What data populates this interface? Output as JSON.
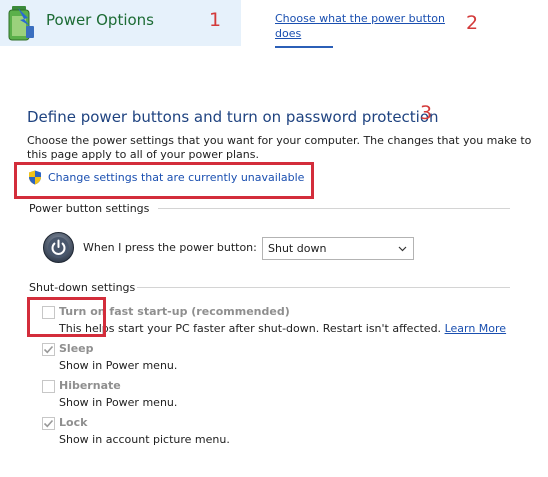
{
  "header": {
    "app_title": "Power Options",
    "side_link": "Choose what the power button does"
  },
  "annotations": {
    "one": "1",
    "two": "2",
    "three": "3"
  },
  "main": {
    "title": "Define power buttons and turn on password protection",
    "description": "Choose the power settings that you want for your computer. The changes that you make to this page apply to all of your power plans.",
    "change_settings_link": "Change settings that are currently unavailable"
  },
  "power_button_settings": {
    "section_label": "Power button settings",
    "press_label": "When I press the power button:",
    "selected_action": "Shut down"
  },
  "shutdown_settings": {
    "section_label": "Shut-down settings",
    "options": [
      {
        "title": "Turn on fast start-up (recommended)",
        "sub": "This helps start your PC faster after shut-down. Restart isn't affected.",
        "link": "Learn More",
        "checked": false
      },
      {
        "title": "Sleep",
        "sub": "Show in Power menu.",
        "checked": true
      },
      {
        "title": "Hibernate",
        "sub": "Show in Power menu.",
        "checked": false
      },
      {
        "title": "Lock",
        "sub": "Show in account picture menu.",
        "checked": true
      }
    ]
  },
  "colors": {
    "link": "#1a4fb0",
    "title_blue": "#1f4380",
    "annotation_red": "#d33a3a",
    "highlight_red": "#d32d3b",
    "tile_bg": "#e6f1fb"
  }
}
